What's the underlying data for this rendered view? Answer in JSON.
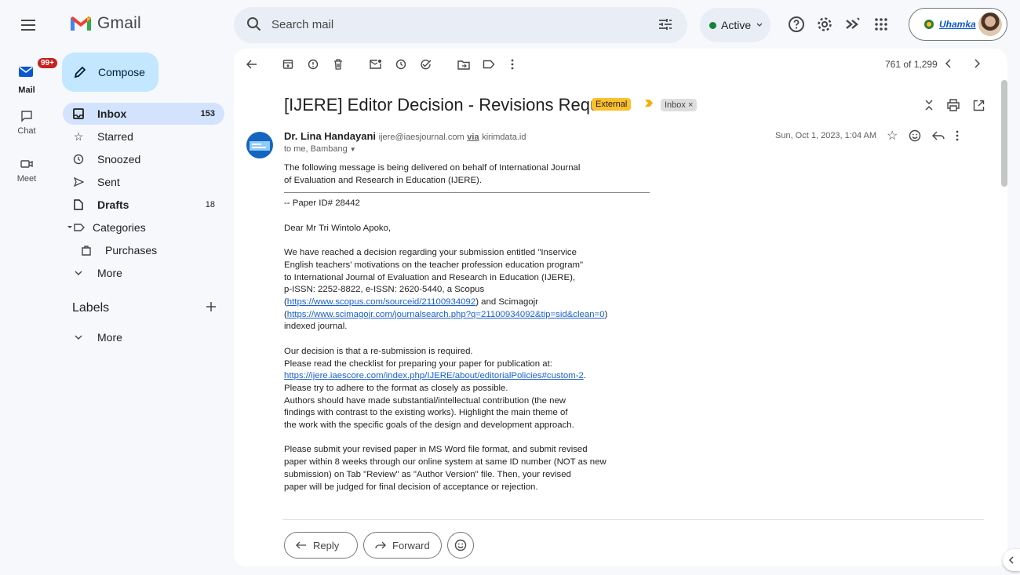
{
  "app": {
    "name": "Gmail"
  },
  "search": {
    "placeholder": "Search mail"
  },
  "status": {
    "label": "Active"
  },
  "account": {
    "org": "Uhamka"
  },
  "rail": {
    "mail": "Mail",
    "mail_badge": "99+",
    "chat": "Chat",
    "meet": "Meet"
  },
  "nav": {
    "compose": "Compose",
    "items": [
      {
        "label": "Inbox",
        "count": "153"
      },
      {
        "label": "Starred",
        "count": ""
      },
      {
        "label": "Snoozed",
        "count": ""
      },
      {
        "label": "Sent",
        "count": ""
      },
      {
        "label": "Drafts",
        "count": "18"
      },
      {
        "label": "Categories",
        "count": ""
      },
      {
        "label": "Purchases",
        "count": ""
      },
      {
        "label": "More",
        "count": ""
      }
    ],
    "labels_heading": "Labels",
    "labels_more": "More"
  },
  "toolbar": {
    "pager": "761 of 1,299"
  },
  "message": {
    "subject": "[IJERE] Editor Decision - Revisions Required",
    "external_label": "External",
    "inbox_label": "Inbox",
    "sender_name": "Dr. Lina Handayani",
    "sender_email": "ijere@iaesjournal.com",
    "via": "via",
    "via_domain": "kirimdata.id",
    "to": "to me, Bambang",
    "date": "Sun, Oct 1, 2023, 1:04 AM",
    "body": {
      "intro_1": "The following message is being delivered on behalf of International Journal",
      "intro_2": "of Evaluation and Research in Education (IJERE).",
      "paper_id": "-- Paper ID# 28442",
      "greeting": "Dear  Mr Tri Wintolo Apoko,",
      "p1_1": "We have reached a decision regarding your submission entitled \"Inservice",
      "p1_2": "English teachers' motivations on the teacher profession education program\"",
      "p1_3": " to International Journal of Evaluation and Research in Education (IJERE),",
      "p1_4": "p-ISSN: 2252-8822, e-ISSN: 2620-5440, a Scopus",
      "p1_5_open": "(",
      "p1_5_link": "https://www.scopus.com/sourceid/21100934092",
      "p1_5_close": ") and Scimagojr",
      "p1_6_open": "(",
      "p1_6_link": "https://www.scimagojr.com/journalsearch.php?q=21100934092&tip=sid&clean=0",
      "p1_6_close": ")",
      "p1_7": "indexed journal.",
      "p2_1": "Our decision is that a re-submission is required.",
      "p2_2": "Please read the checklist for preparing your paper for publication at:",
      "p2_3_link": "https://ijere.iaescore.com/index.php/IJERE/about/editorialPolicies#custom-2",
      "p2_3_end": ".",
      "p2_4": "Please try to adhere to the format as closely as possible.",
      "p2_5": "Authors should have made substantial/intellectual contribution (the new",
      "p2_6": "findings with contrast to the existing works). Highlight the main theme of",
      "p2_7": "the work with the specific goals of the design and development approach.",
      "p3_1": "Please submit your revised paper in MS Word file format, and submit revised",
      "p3_2": "paper within 8 weeks through our online system at same ID number (NOT as new",
      "p3_3": "submission) on Tab \"Review\" as \"Author Version\" file. Then, your revised",
      "p3_4": "paper will be judged for final decision of acceptance or rejection."
    }
  },
  "actions": {
    "reply": "Reply",
    "forward": "Forward"
  },
  "colors": {
    "compose_bg": "#c2e7ff",
    "selected_nav": "#d3e3fd",
    "external_badge": "#fbc02d",
    "badge_red": "#c5221f",
    "active_dot": "#188038"
  }
}
